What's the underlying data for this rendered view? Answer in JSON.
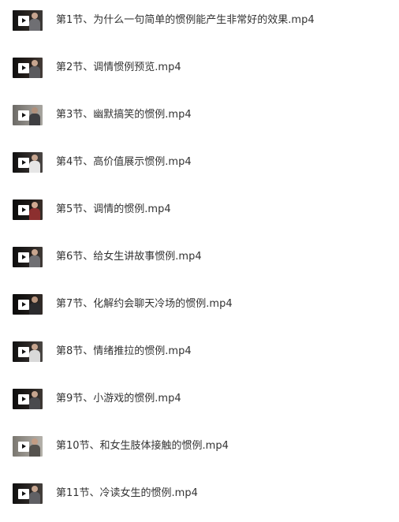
{
  "files": [
    {
      "name": "第1节、为什么一句简单的惯例能产生非常好的效果.mp4",
      "icon": "video-thumbnail-icon"
    },
    {
      "name": "第2节、调情惯例预览.mp4",
      "icon": "video-thumbnail-icon"
    },
    {
      "name": "第3节、幽默搞笑的惯例.mp4",
      "icon": "video-thumbnail-icon"
    },
    {
      "name": "第4节、高价值展示惯例.mp4",
      "icon": "video-thumbnail-icon"
    },
    {
      "name": "第5节、调情的惯例.mp4",
      "icon": "video-thumbnail-icon"
    },
    {
      "name": "第6节、给女生讲故事惯例.mp4",
      "icon": "video-thumbnail-icon"
    },
    {
      "name": "第7节、化解约会聊天冷场的惯例.mp4",
      "icon": "video-thumbnail-icon"
    },
    {
      "name": "第8节、情绪推拉的惯例.mp4",
      "icon": "video-thumbnail-icon"
    },
    {
      "name": "第9节、小游戏的惯例.mp4",
      "icon": "video-thumbnail-icon"
    },
    {
      "name": "第10节、和女生肢体接触的惯例.mp4",
      "icon": "video-thumbnail-icon"
    },
    {
      "name": "第11节、冷读女生的惯例.mp4",
      "icon": "video-thumbnail-icon"
    }
  ],
  "colors": {
    "background": "#ffffff",
    "text": "#333333",
    "thumbnail_dark": "#1a1a1a",
    "thumbnail_light": "#a8a6a0",
    "play_button": "#ffffff"
  }
}
